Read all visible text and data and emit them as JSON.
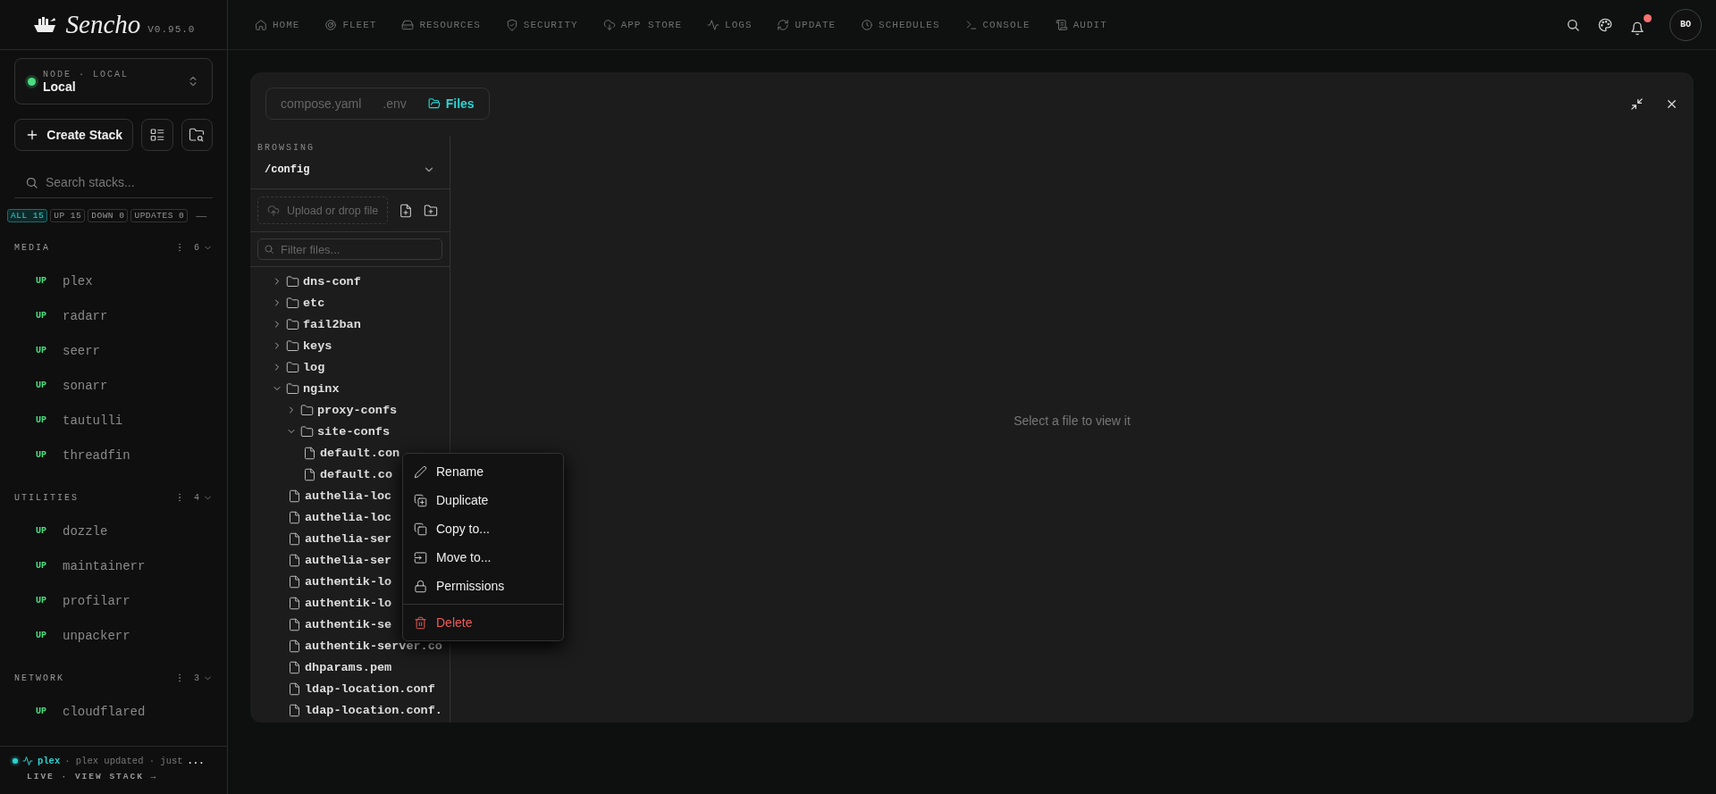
{
  "brand": {
    "name": "Sencho",
    "version": "V0.95.0"
  },
  "nav": [
    {
      "label": "HOME",
      "selected": false
    },
    {
      "label": "FLEET",
      "selected": false
    },
    {
      "label": "RESOURCES",
      "selected": false
    },
    {
      "label": "SECURITY",
      "selected": false
    },
    {
      "label": "APP STORE",
      "selected": false
    },
    {
      "label": "LOGS",
      "selected": false
    },
    {
      "label": "UPDATE",
      "selected": false
    },
    {
      "label": "SCHEDULES",
      "selected": false
    },
    {
      "label": "CONSOLE",
      "selected": false
    },
    {
      "label": "AUDIT",
      "selected": false
    }
  ],
  "header": {
    "notification_dot": true,
    "avatar": "BO"
  },
  "node": {
    "label": "NODE · LOCAL",
    "name": "Local",
    "online": true
  },
  "create_button": "Create Stack",
  "search": {
    "placeholder": "Search stacks..."
  },
  "filters": [
    {
      "label": "ALL",
      "count": "15",
      "selected": true
    },
    {
      "label": "UP",
      "count": "15",
      "selected": false
    },
    {
      "label": "DOWN",
      "count": "0",
      "selected": false
    },
    {
      "label": "UPDATES",
      "count": "0",
      "selected": false
    }
  ],
  "collapse_symbol": "—",
  "groups": [
    {
      "name": "MEDIA",
      "count": "6",
      "expanded": true,
      "stacks": [
        {
          "status": "UP",
          "name": "plex"
        },
        {
          "status": "UP",
          "name": "radarr"
        },
        {
          "status": "UP",
          "name": "seerr"
        },
        {
          "status": "UP",
          "name": "sonarr"
        },
        {
          "status": "UP",
          "name": "tautulli"
        },
        {
          "status": "UP",
          "name": "threadfin"
        }
      ]
    },
    {
      "name": "UTILITIES",
      "count": "4",
      "expanded": true,
      "stacks": [
        {
          "status": "UP",
          "name": "dozzle"
        },
        {
          "status": "UP",
          "name": "maintainerr"
        },
        {
          "status": "UP",
          "name": "profilarr"
        },
        {
          "status": "UP",
          "name": "unpackerr"
        }
      ]
    },
    {
      "name": "NETWORK",
      "count": "3",
      "expanded": true,
      "stacks": [
        {
          "status": "UP",
          "name": "cloudflared"
        }
      ]
    }
  ],
  "activity": {
    "stack": "plex",
    "message": "· plex updated · just",
    "more": "...",
    "footer": "LIVE · VIEW STACK →"
  },
  "editor": {
    "tabs": [
      {
        "label": "compose.yaml",
        "selected": false
      },
      {
        "label": ".env",
        "selected": false
      },
      {
        "label": "Files",
        "selected": true
      }
    ],
    "browsing_label": "BROWSING",
    "path": "/config",
    "upload_placeholder": "Upload or drop file",
    "filter_placeholder": "Filter files...",
    "tree": [
      {
        "name": "dns-conf",
        "kind": "folder",
        "expanded": false
      },
      {
        "name": "etc",
        "kind": "folder",
        "expanded": false
      },
      {
        "name": "fail2ban",
        "kind": "folder",
        "expanded": false
      },
      {
        "name": "keys",
        "kind": "folder",
        "expanded": false
      },
      {
        "name": "log",
        "kind": "folder",
        "expanded": false
      },
      {
        "name": "nginx",
        "kind": "folder",
        "expanded": true,
        "children": [
          {
            "name": "proxy-confs",
            "kind": "folder",
            "expanded": false
          },
          {
            "name": "site-confs",
            "kind": "folder",
            "expanded": true,
            "children": [
              {
                "name": "default.con",
                "kind": "file"
              },
              {
                "name": "default.co",
                "kind": "file"
              }
            ]
          },
          {
            "name": "authelia-loc",
            "kind": "file"
          },
          {
            "name": "authelia-loc",
            "kind": "file"
          },
          {
            "name": "authelia-ser",
            "kind": "file"
          },
          {
            "name": "authelia-ser",
            "kind": "file"
          },
          {
            "name": "authentik-lo",
            "kind": "file"
          },
          {
            "name": "authentik-lo",
            "kind": "file"
          },
          {
            "name": "authentik-se",
            "kind": "file"
          },
          {
            "name": "authentik-server.co",
            "kind": "file"
          },
          {
            "name": "dhparams.pem",
            "kind": "file"
          },
          {
            "name": "ldap-location.conf",
            "kind": "file"
          },
          {
            "name": "ldap-location.conf.",
            "kind": "file"
          }
        ]
      }
    ],
    "empty_message": "Select a file to view it"
  },
  "context_menu": {
    "items": [
      {
        "label": "Rename",
        "kind": "normal"
      },
      {
        "label": "Duplicate",
        "kind": "normal"
      },
      {
        "label": "Copy to...",
        "kind": "normal"
      },
      {
        "label": "Move to...",
        "kind": "normal"
      },
      {
        "label": "Permissions",
        "kind": "normal"
      },
      {
        "label": "Delete",
        "kind": "danger"
      }
    ]
  }
}
